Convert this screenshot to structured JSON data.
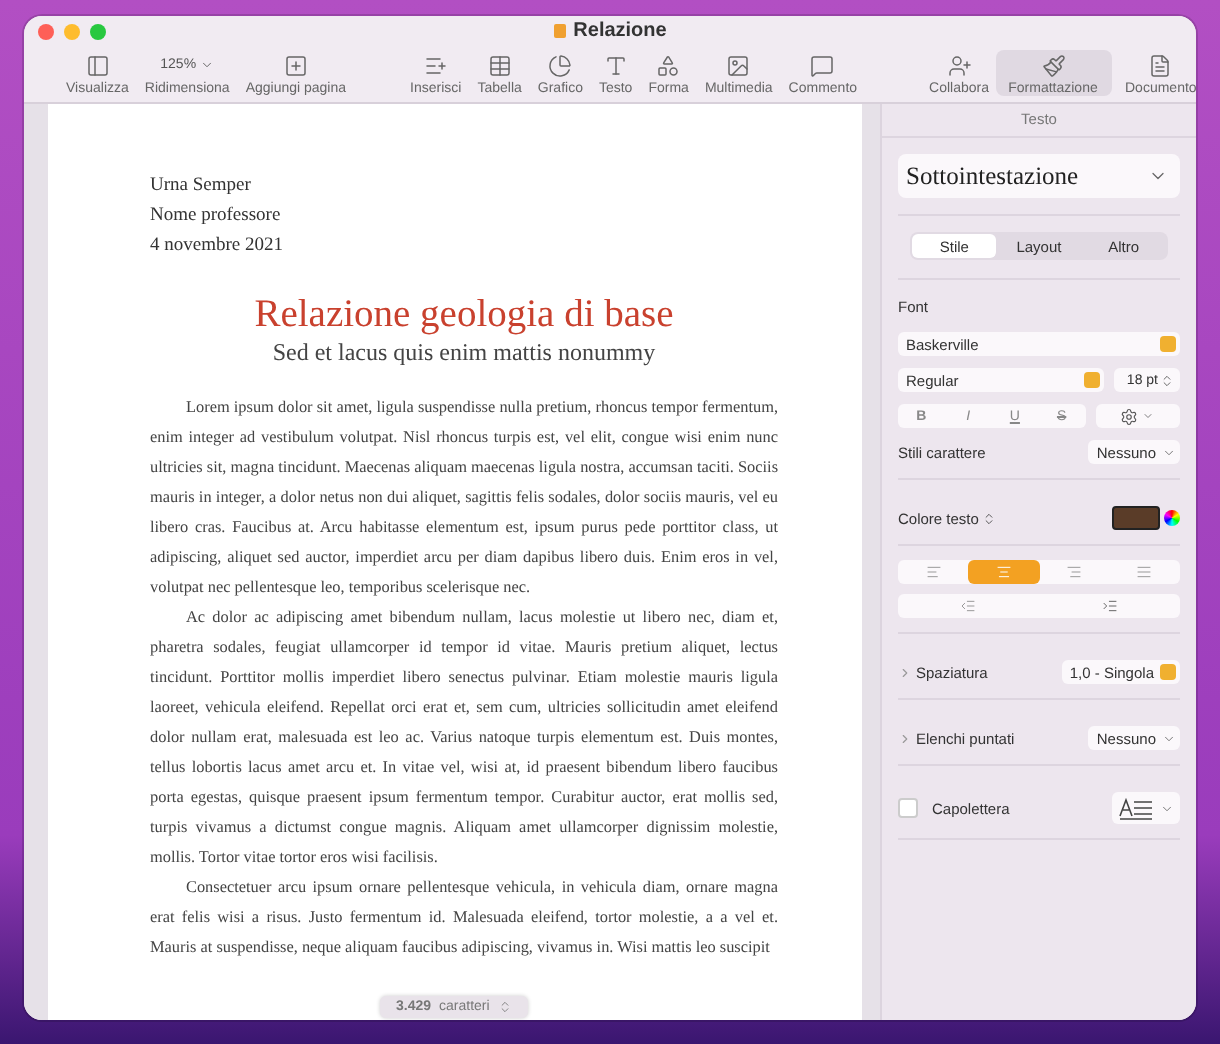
{
  "window": {
    "title": "Relazione"
  },
  "toolbar_groups": [
    {
      "items": [
        {
          "kind": "button",
          "label": "Visualizza",
          "selected": false
        },
        {
          "kind": "zoom",
          "label": "Ridimensiona",
          "value": "125%",
          "selected": false
        },
        {
          "kind": "button",
          "label": "Aggiungi pagina",
          "selected": false
        }
      ]
    },
    {
      "items": [
        {
          "kind": "button",
          "label": "Inserisci",
          "selected": false
        },
        {
          "kind": "button",
          "label": "Tabella",
          "selected": false
        },
        {
          "kind": "button",
          "label": "Grafico",
          "selected": false
        },
        {
          "kind": "button",
          "label": "Testo",
          "selected": false
        },
        {
          "kind": "button",
          "label": "Forma",
          "selected": false
        },
        {
          "kind": "button",
          "label": "Multimedia",
          "selected": false
        },
        {
          "kind": "button",
          "label": "Commento",
          "selected": false
        }
      ]
    },
    {
      "items": [
        {
          "kind": "button",
          "label": "Collabora",
          "selected": false
        }
      ]
    },
    {
      "items": [
        {
          "kind": "button",
          "label": "Formattazione",
          "selected": true
        },
        {
          "kind": "button",
          "label": "Documento",
          "selected": false
        }
      ]
    }
  ],
  "document": {
    "header_lines": [
      "Urna Semper",
      "Nome professore",
      "4 novembre 2021"
    ],
    "title": "Relazione geologia di base",
    "subtitle": "Sed et lacus quis enim mattis nonummy",
    "paragraphs": [
      "Lorem ipsum dolor sit amet, ligula suspendisse nulla pretium, rhoncus tempor fermentum, enim integer ad vestibulum volutpat. Nisl rhoncus turpis est, vel elit, congue wisi enim nunc ultricies sit, magna tincidunt. Maecenas aliquam maecenas ligula nostra, accumsan taciti. Sociis mauris in integer, a dolor netus non dui aliquet, sagittis felis sodales, dolor sociis mauris, vel eu libero cras. Faucibus at. Arcu habitasse elementum est, ipsum purus pede porttitor class, ut adipiscing, aliquet sed auctor, imperdiet arcu per diam dapibus libero duis. Enim eros in vel, volutpat nec pellentesque leo, temporibus scelerisque nec.",
      "Ac dolor ac adipiscing amet bibendum nullam, lacus molestie ut libero nec, diam et, pharetra sodales, feugiat ullamcorper id tempor id vitae. Mauris pretium aliquet, lectus tincidunt. Porttitor mollis imperdiet libero senectus pulvinar. Etiam molestie mauris ligula laoreet, vehicula eleifend. Repellat orci erat et, sem cum, ultricies sollicitudin amet eleifend dolor nullam erat, malesuada est leo ac. Varius natoque turpis elementum est. Duis montes, tellus lobortis lacus amet arcu et. In vitae vel, wisi at, id praesent bibendum libero faucibus porta egestas, quisque praesent ipsum fermentum tempor. Curabitur auctor, erat mollis sed, turpis vivamus a dictumst congue magnis. Aliquam amet ullamcorper dignissim molestie, mollis. Tortor vitae tortor eros wisi facilisis.",
      "Consectetuer arcu ipsum ornare pellentesque vehicula, in vehicula diam, ornare magna erat felis wisi a risus. Justo fermentum id. Malesuada eleifend, tortor molestie, a a vel et. Mauris at suspendisse, neque aliquam faucibus adipiscing, vivamus in. Wisi mattis leo suscipit"
    ]
  },
  "word_count": {
    "count": "3.429",
    "unit": "caratteri"
  },
  "sidebar": {
    "tab": "Testo",
    "paragraph_style": "Sottointestazione",
    "segments": [
      {
        "label": "Stile",
        "selected": true
      },
      {
        "label": "Layout",
        "selected": false
      },
      {
        "label": "Altro",
        "selected": false
      }
    ],
    "font": {
      "label": "Font",
      "family": "Baskerville",
      "typeface": "Regular",
      "size": "18 pt"
    },
    "text_styles": [
      {
        "kind": "bold",
        "label": "B",
        "on": false
      },
      {
        "kind": "italic",
        "label": "I",
        "on": false
      },
      {
        "kind": "underline",
        "label": "U",
        "on": false
      },
      {
        "kind": "strike",
        "label": "S",
        "on": false
      }
    ],
    "character_styles": {
      "label": "Stili carattere",
      "value": "Nessuno"
    },
    "text_color": {
      "label": "Colore testo",
      "color": "#5a3c28"
    },
    "alignment": [
      {
        "kind": "left",
        "selected": false
      },
      {
        "kind": "center",
        "selected": true
      },
      {
        "kind": "right",
        "selected": false
      },
      {
        "kind": "justify",
        "selected": false
      }
    ],
    "spacing": {
      "label": "Spaziatura",
      "value": "1,0 - Singola",
      "expanded": false
    },
    "bullets": {
      "label": "Elenchi puntati",
      "value": "Nessuno",
      "expanded": false
    },
    "drop_cap": {
      "label": "Capolettera",
      "checked": false
    }
  }
}
